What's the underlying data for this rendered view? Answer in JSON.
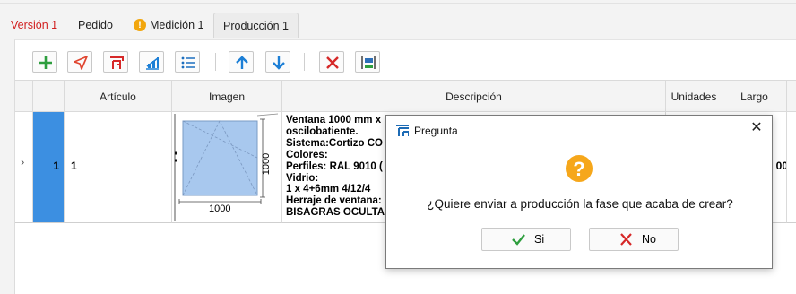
{
  "tabs": [
    {
      "label": "Versión 1"
    },
    {
      "label": "Pedido"
    },
    {
      "label": "Medición 1"
    },
    {
      "label": "Producción 1"
    }
  ],
  "toolbar": {
    "buttons": [
      "add-icon",
      "send-icon",
      "profile-icon",
      "chart-icon",
      "list-icon",
      "arrow-up-icon",
      "arrow-down-icon",
      "delete-icon",
      "layout-icon"
    ]
  },
  "grid": {
    "columns": [
      "Artículo",
      "Imagen",
      "Descripción",
      "Unidades",
      "Largo"
    ],
    "row": {
      "pointer": "›",
      "index": "1",
      "articulo": "1",
      "image_width": "1000",
      "image_height": "1000",
      "description": "Ventana 1000 mm x\noscilobatiente.\nSistema:Cortizo CO\nColores:\nPerfiles: RAL 9010 (\nVidrio:\n1 x 4+6mm 4/12/4\nHerraje de ventana:\nBISAGRAS OCULTA",
      "largo_partial": "00"
    }
  },
  "dialog": {
    "title": "Pregunta",
    "close_glyph": "✕",
    "question_glyph": "?",
    "message": "¿Quiere enviar a producción la fase que acaba de crear?",
    "yes_label": "Si",
    "no_label": "No"
  },
  "colors": {
    "version_tab": "#d11f1f",
    "selection": "#3c8fe1",
    "warning": "#f2a60c",
    "question": "#f6a71b",
    "yes_check": "#2e9e3e",
    "no_x": "#d62828",
    "window_glass": "#a8c8ee"
  }
}
